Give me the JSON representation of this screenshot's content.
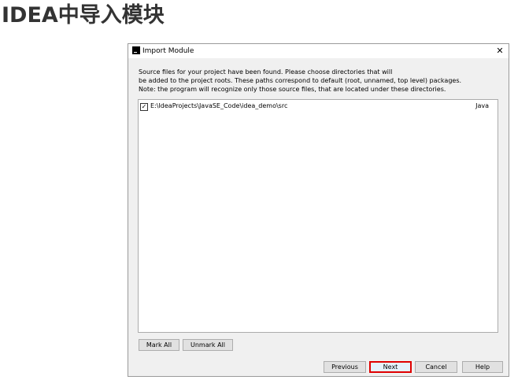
{
  "page": {
    "heading": "IDEA中导入模块"
  },
  "dialog": {
    "title": "Import Module",
    "app_icon": "intellij-icon",
    "close_symbol": "✕",
    "description": [
      "Source files for your project have been found. Please choose directories that will",
      "be added to the project roots. These paths correspond to default (root, unnamed, top level) packages.",
      "Note: the program will recognize only those source files, that are located under these directories."
    ],
    "directories": [
      {
        "checked": true,
        "check_symbol": "✓",
        "path": "E:\\IdeaProjects\\JavaSE_Code\\idea_demo\\src",
        "type": "Java"
      }
    ],
    "buttons": {
      "mark_all": "Mark All",
      "unmark_all": "Unmark All",
      "previous": "Previous",
      "next": "Next",
      "cancel": "Cancel",
      "help": "Help"
    },
    "colors": {
      "highlight": "#e00000"
    }
  }
}
